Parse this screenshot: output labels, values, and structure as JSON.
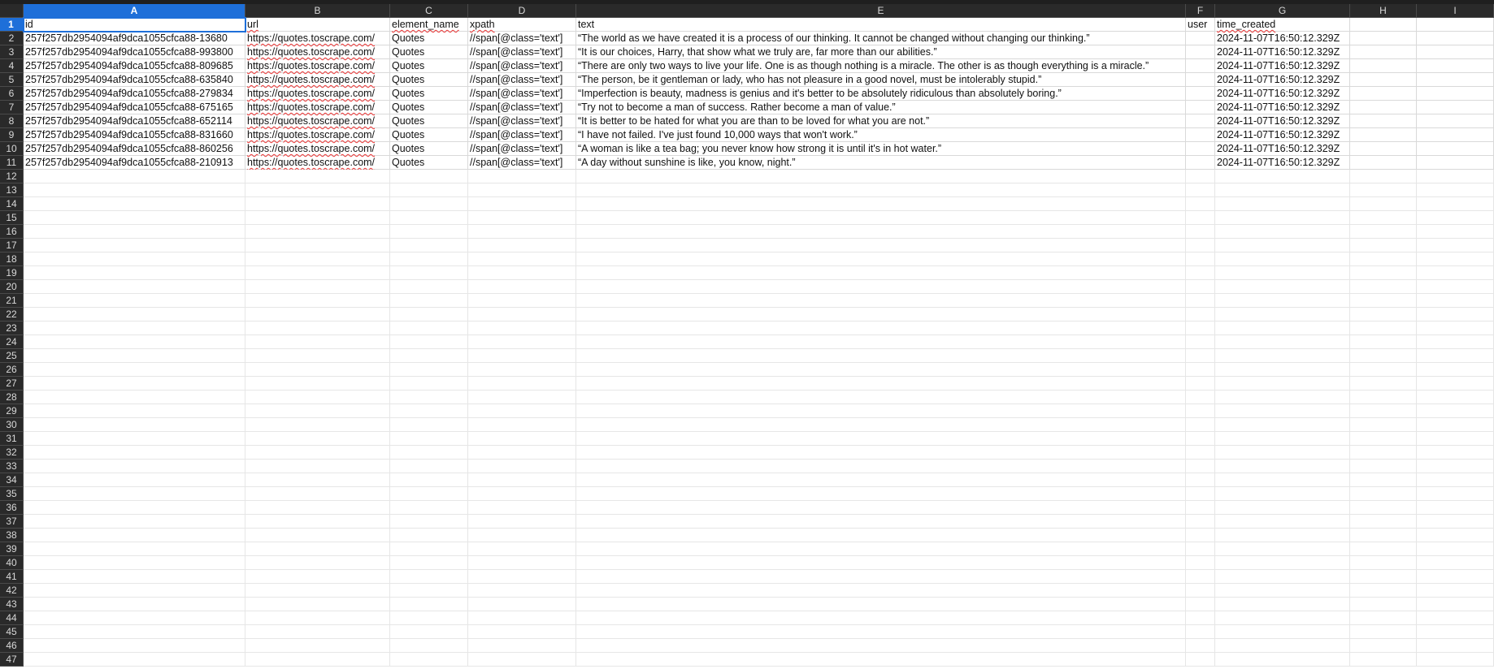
{
  "columns": [
    "A",
    "B",
    "C",
    "D",
    "E",
    "F",
    "G",
    "H",
    "I"
  ],
  "rows_total": 47,
  "active_cell": {
    "col": "A",
    "row": 1
  },
  "header_row": {
    "A": "id",
    "B": "url",
    "C": "element_name",
    "D": "xpath",
    "E": "text",
    "F": "user",
    "G": "time_created"
  },
  "data_rows": [
    {
      "A": "257f257db2954094af9dca1055cfca88-13680",
      "B": "https://quotes.toscrape.com/",
      "C": "Quotes",
      "D": "//span[@class='text']",
      "E": "“The world as we have created it is a process of our thinking. It cannot be changed without changing our thinking.”",
      "F": "",
      "G": "2024-11-07T16:50:12.329Z"
    },
    {
      "A": "257f257db2954094af9dca1055cfca88-993800",
      "B": "https://quotes.toscrape.com/",
      "C": "Quotes",
      "D": "//span[@class='text']",
      "E": "“It is our choices, Harry, that show what we truly are, far more than our abilities.”",
      "F": "",
      "G": "2024-11-07T16:50:12.329Z"
    },
    {
      "A": "257f257db2954094af9dca1055cfca88-809685",
      "B": "https://quotes.toscrape.com/",
      "C": "Quotes",
      "D": "//span[@class='text']",
      "E": "“There are only two ways to live your life. One is as though nothing is a miracle. The other is as though everything is a miracle.”",
      "F": "",
      "G": "2024-11-07T16:50:12.329Z"
    },
    {
      "A": "257f257db2954094af9dca1055cfca88-635840",
      "B": "https://quotes.toscrape.com/",
      "C": "Quotes",
      "D": "//span[@class='text']",
      "E": "“The person, be it gentleman or lady, who has not pleasure in a good novel, must be intolerably stupid.”",
      "F": "",
      "G": "2024-11-07T16:50:12.329Z"
    },
    {
      "A": "257f257db2954094af9dca1055cfca88-279834",
      "B": "https://quotes.toscrape.com/",
      "C": "Quotes",
      "D": "//span[@class='text']",
      "E": "“Imperfection is beauty, madness is genius and it's better to be absolutely ridiculous than absolutely boring.”",
      "F": "",
      "G": "2024-11-07T16:50:12.329Z"
    },
    {
      "A": "257f257db2954094af9dca1055cfca88-675165",
      "B": "https://quotes.toscrape.com/",
      "C": "Quotes",
      "D": "//span[@class='text']",
      "E": "“Try not to become a man of success. Rather become a man of value.”",
      "F": "",
      "G": "2024-11-07T16:50:12.329Z"
    },
    {
      "A": "257f257db2954094af9dca1055cfca88-652114",
      "B": "https://quotes.toscrape.com/",
      "C": "Quotes",
      "D": "//span[@class='text']",
      "E": "“It is better to be hated for what you are than to be loved for what you are not.”",
      "F": "",
      "G": "2024-11-07T16:50:12.329Z"
    },
    {
      "A": "257f257db2954094af9dca1055cfca88-831660",
      "B": "https://quotes.toscrape.com/",
      "C": "Quotes",
      "D": "//span[@class='text']",
      "E": "“I have not failed. I've just found 10,000 ways that won't work.”",
      "F": "",
      "G": "2024-11-07T16:50:12.329Z"
    },
    {
      "A": "257f257db2954094af9dca1055cfca88-860256",
      "B": "https://quotes.toscrape.com/",
      "C": "Quotes",
      "D": "//span[@class='text']",
      "E": "“A woman is like a tea bag; you never know how strong it is until it's in hot water.”",
      "F": "",
      "G": "2024-11-07T16:50:12.329Z"
    },
    {
      "A": "257f257db2954094af9dca1055cfca88-210913",
      "B": "https://quotes.toscrape.com/",
      "C": "Quotes",
      "D": "//span[@class='text']",
      "E": "“A day without sunshine is like, you know, night.”",
      "F": "",
      "G": "2024-11-07T16:50:12.329Z"
    }
  ],
  "colors": {
    "header_bg": "#2a2a2a",
    "header_text": "#d8d8d8",
    "active_header": "#1e6fd9",
    "grid": "#d9d9d9",
    "spellcheck_underline": "#e33"
  }
}
